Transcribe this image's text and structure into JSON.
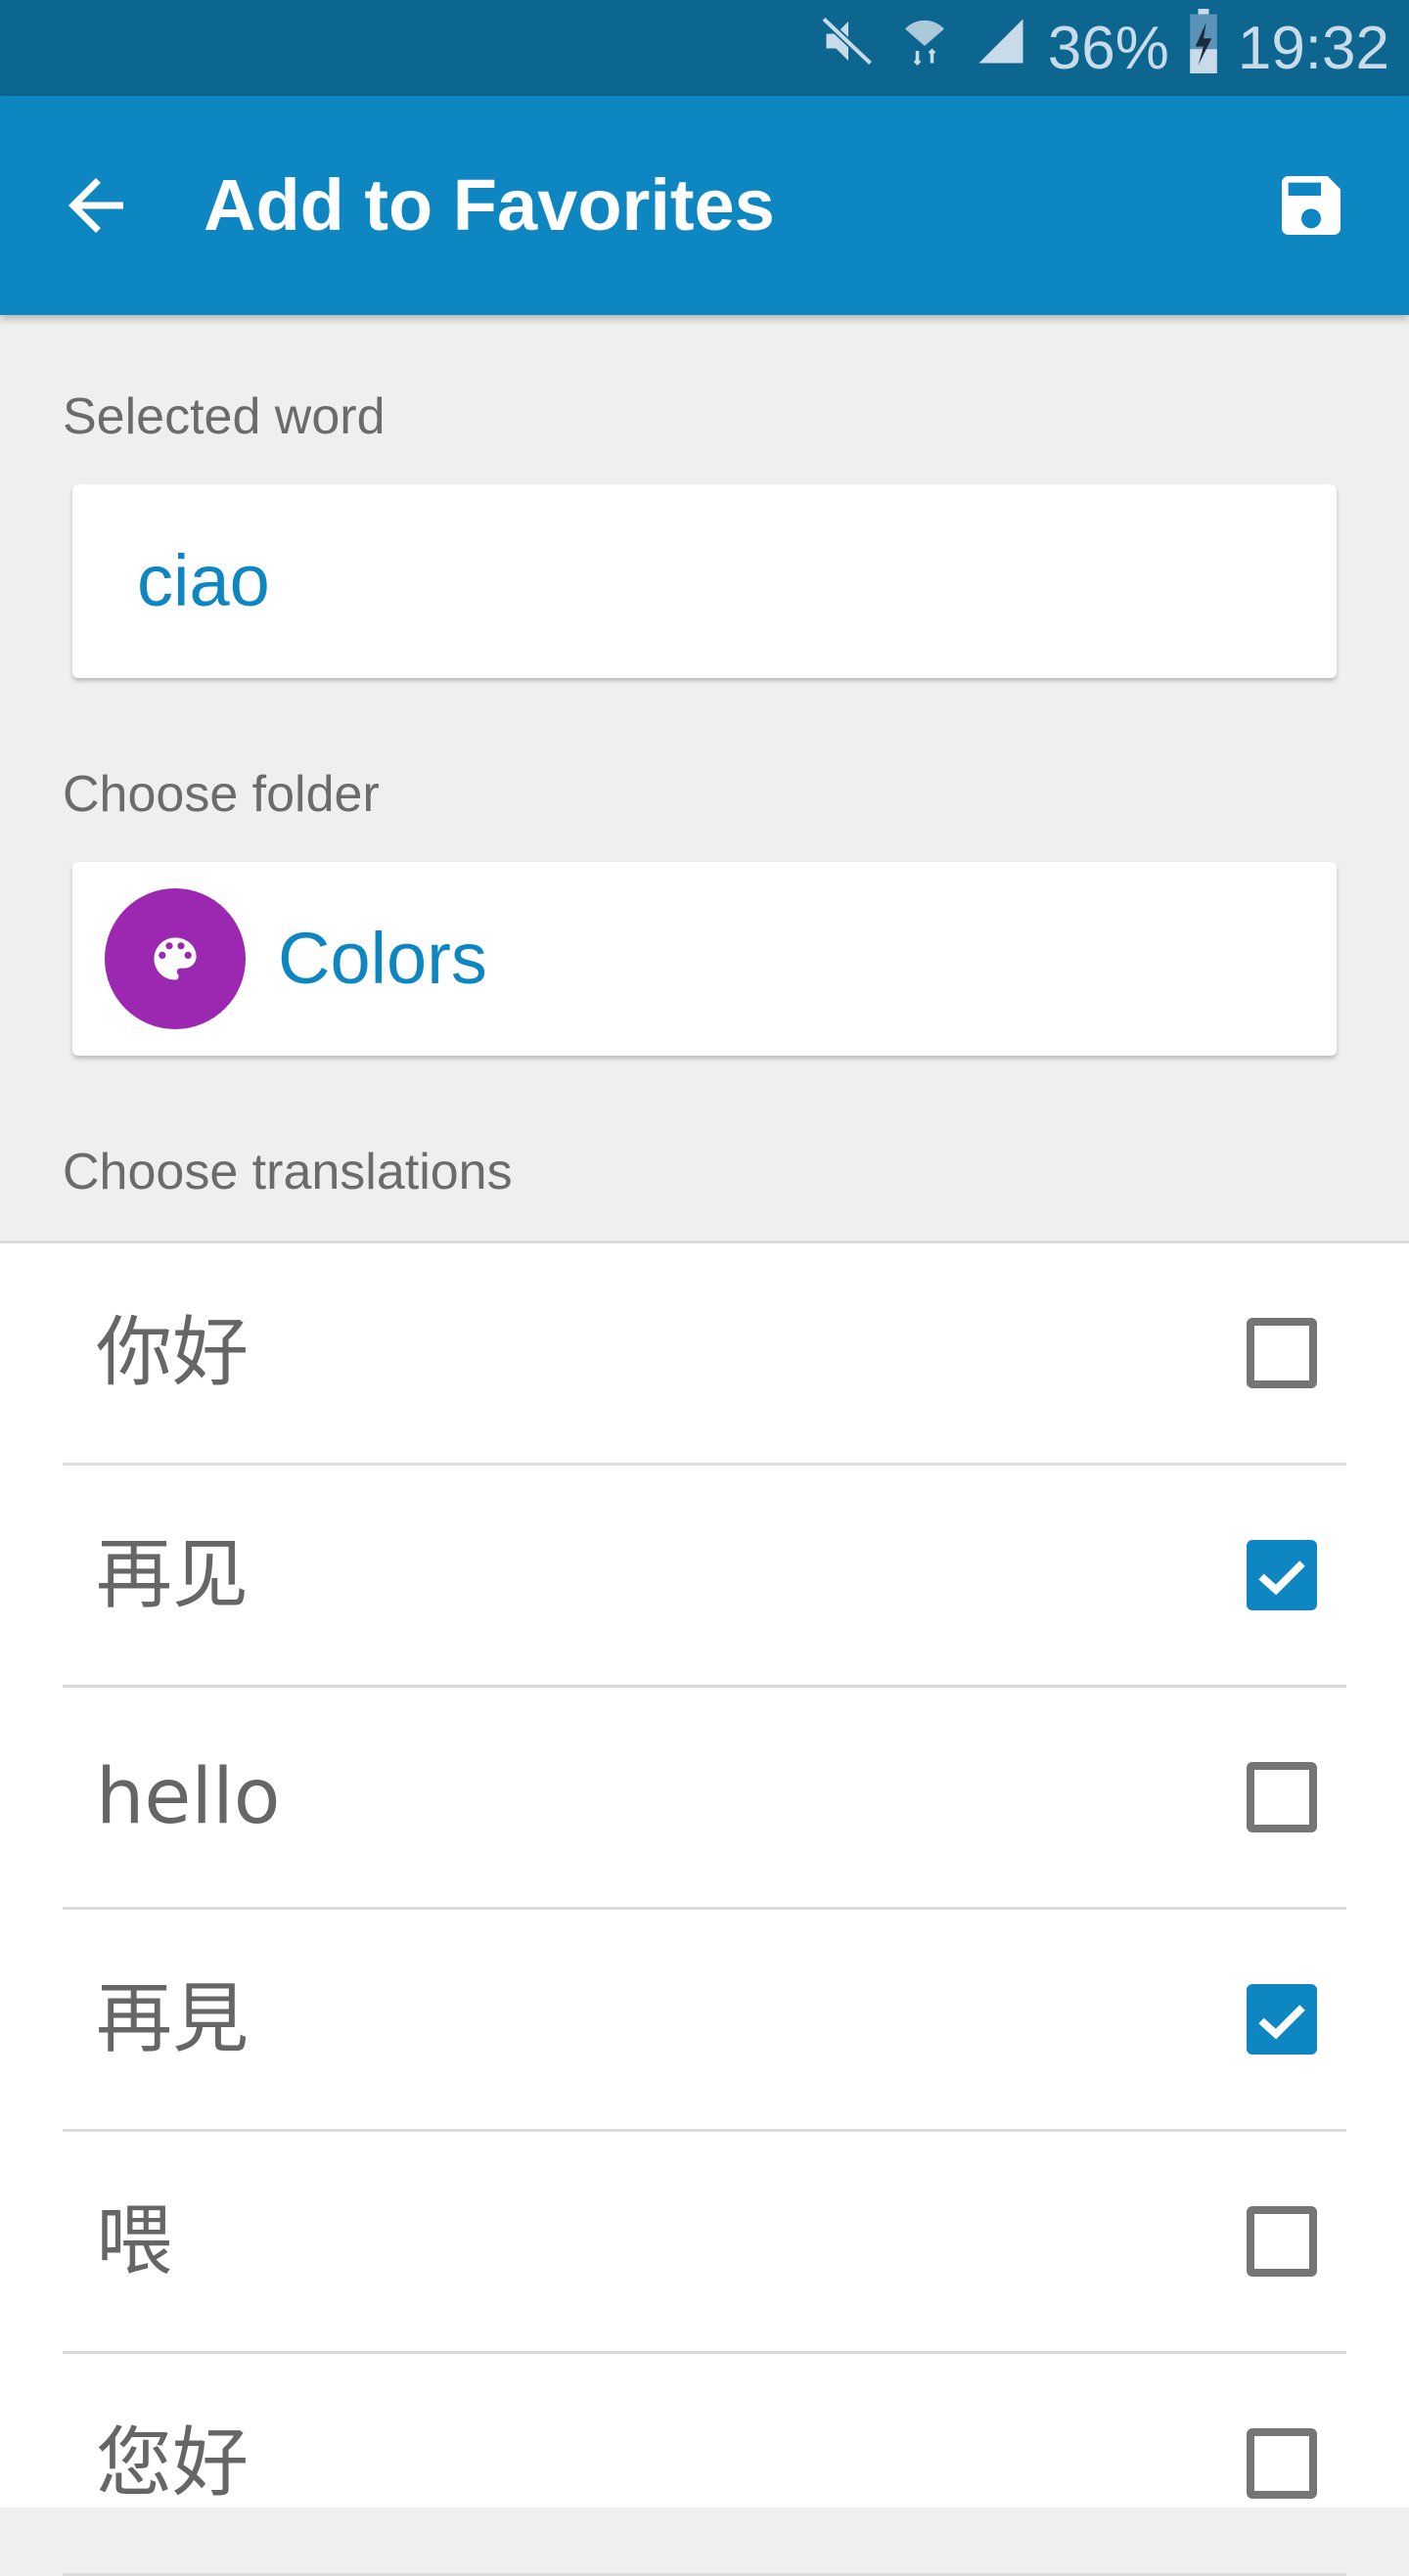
{
  "status_bar": {
    "icons": [
      "mute-icon",
      "wifi-icon",
      "signal-icon",
      "battery-charging-icon"
    ],
    "battery": "36%",
    "time": "19:32"
  },
  "app_bar": {
    "back_icon": "arrow-left-icon",
    "title": "Add to Favorites",
    "save_icon": "floppy-save-icon"
  },
  "selected_word": {
    "label": "Selected word",
    "value": "ciao"
  },
  "folder": {
    "label": "Choose folder",
    "icon": "palette-icon",
    "icon_color": "#9c27b0",
    "name": "Colors"
  },
  "translations": {
    "label": "Choose translations",
    "items": [
      {
        "text": "你好",
        "checked": false
      },
      {
        "text": "再见",
        "checked": true
      },
      {
        "text": "hello",
        "checked": false
      },
      {
        "text": "再見",
        "checked": true
      },
      {
        "text": "喂",
        "checked": false
      },
      {
        "text": "您好",
        "checked": false
      }
    ]
  },
  "colors": {
    "status_bar": "#0c6690",
    "primary": "#0d86c1",
    "background": "#efefef",
    "text_secondary": "#6b6b6b"
  }
}
